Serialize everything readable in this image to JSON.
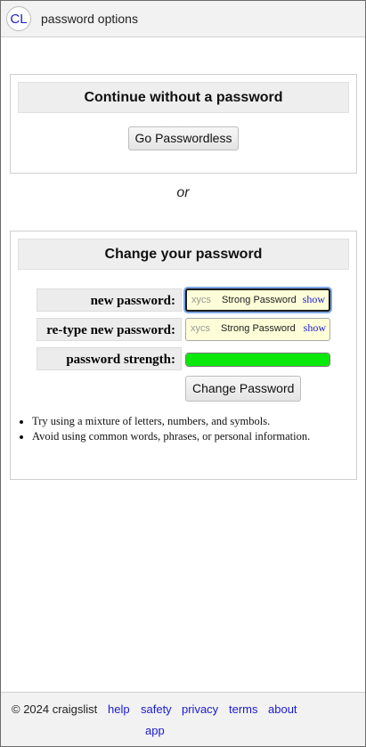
{
  "header": {
    "logo_text": "CL",
    "title": "password options"
  },
  "passwordless": {
    "heading": "Continue without a password",
    "button_label": "Go Passwordless"
  },
  "separator": "or",
  "change": {
    "heading": "Change your password",
    "fields": [
      {
        "label": "new password:",
        "value": "xycs",
        "hint": "Strong Password",
        "show_label": "show"
      },
      {
        "label": "re-type new password:",
        "value": "xycs",
        "hint": "Strong Password",
        "show_label": "show"
      }
    ],
    "strength": {
      "label": "password strength:",
      "level": 1.0,
      "color": "#0be80b"
    },
    "submit_label": "Change Password",
    "tips": [
      "Try using a mixture of letters, numbers, and symbols.",
      "Avoid using common words, phrases, or personal information."
    ]
  },
  "footer": {
    "copyright": "© 2024 craigslist",
    "links": [
      "help",
      "safety",
      "privacy",
      "terms",
      "about",
      "app"
    ]
  }
}
